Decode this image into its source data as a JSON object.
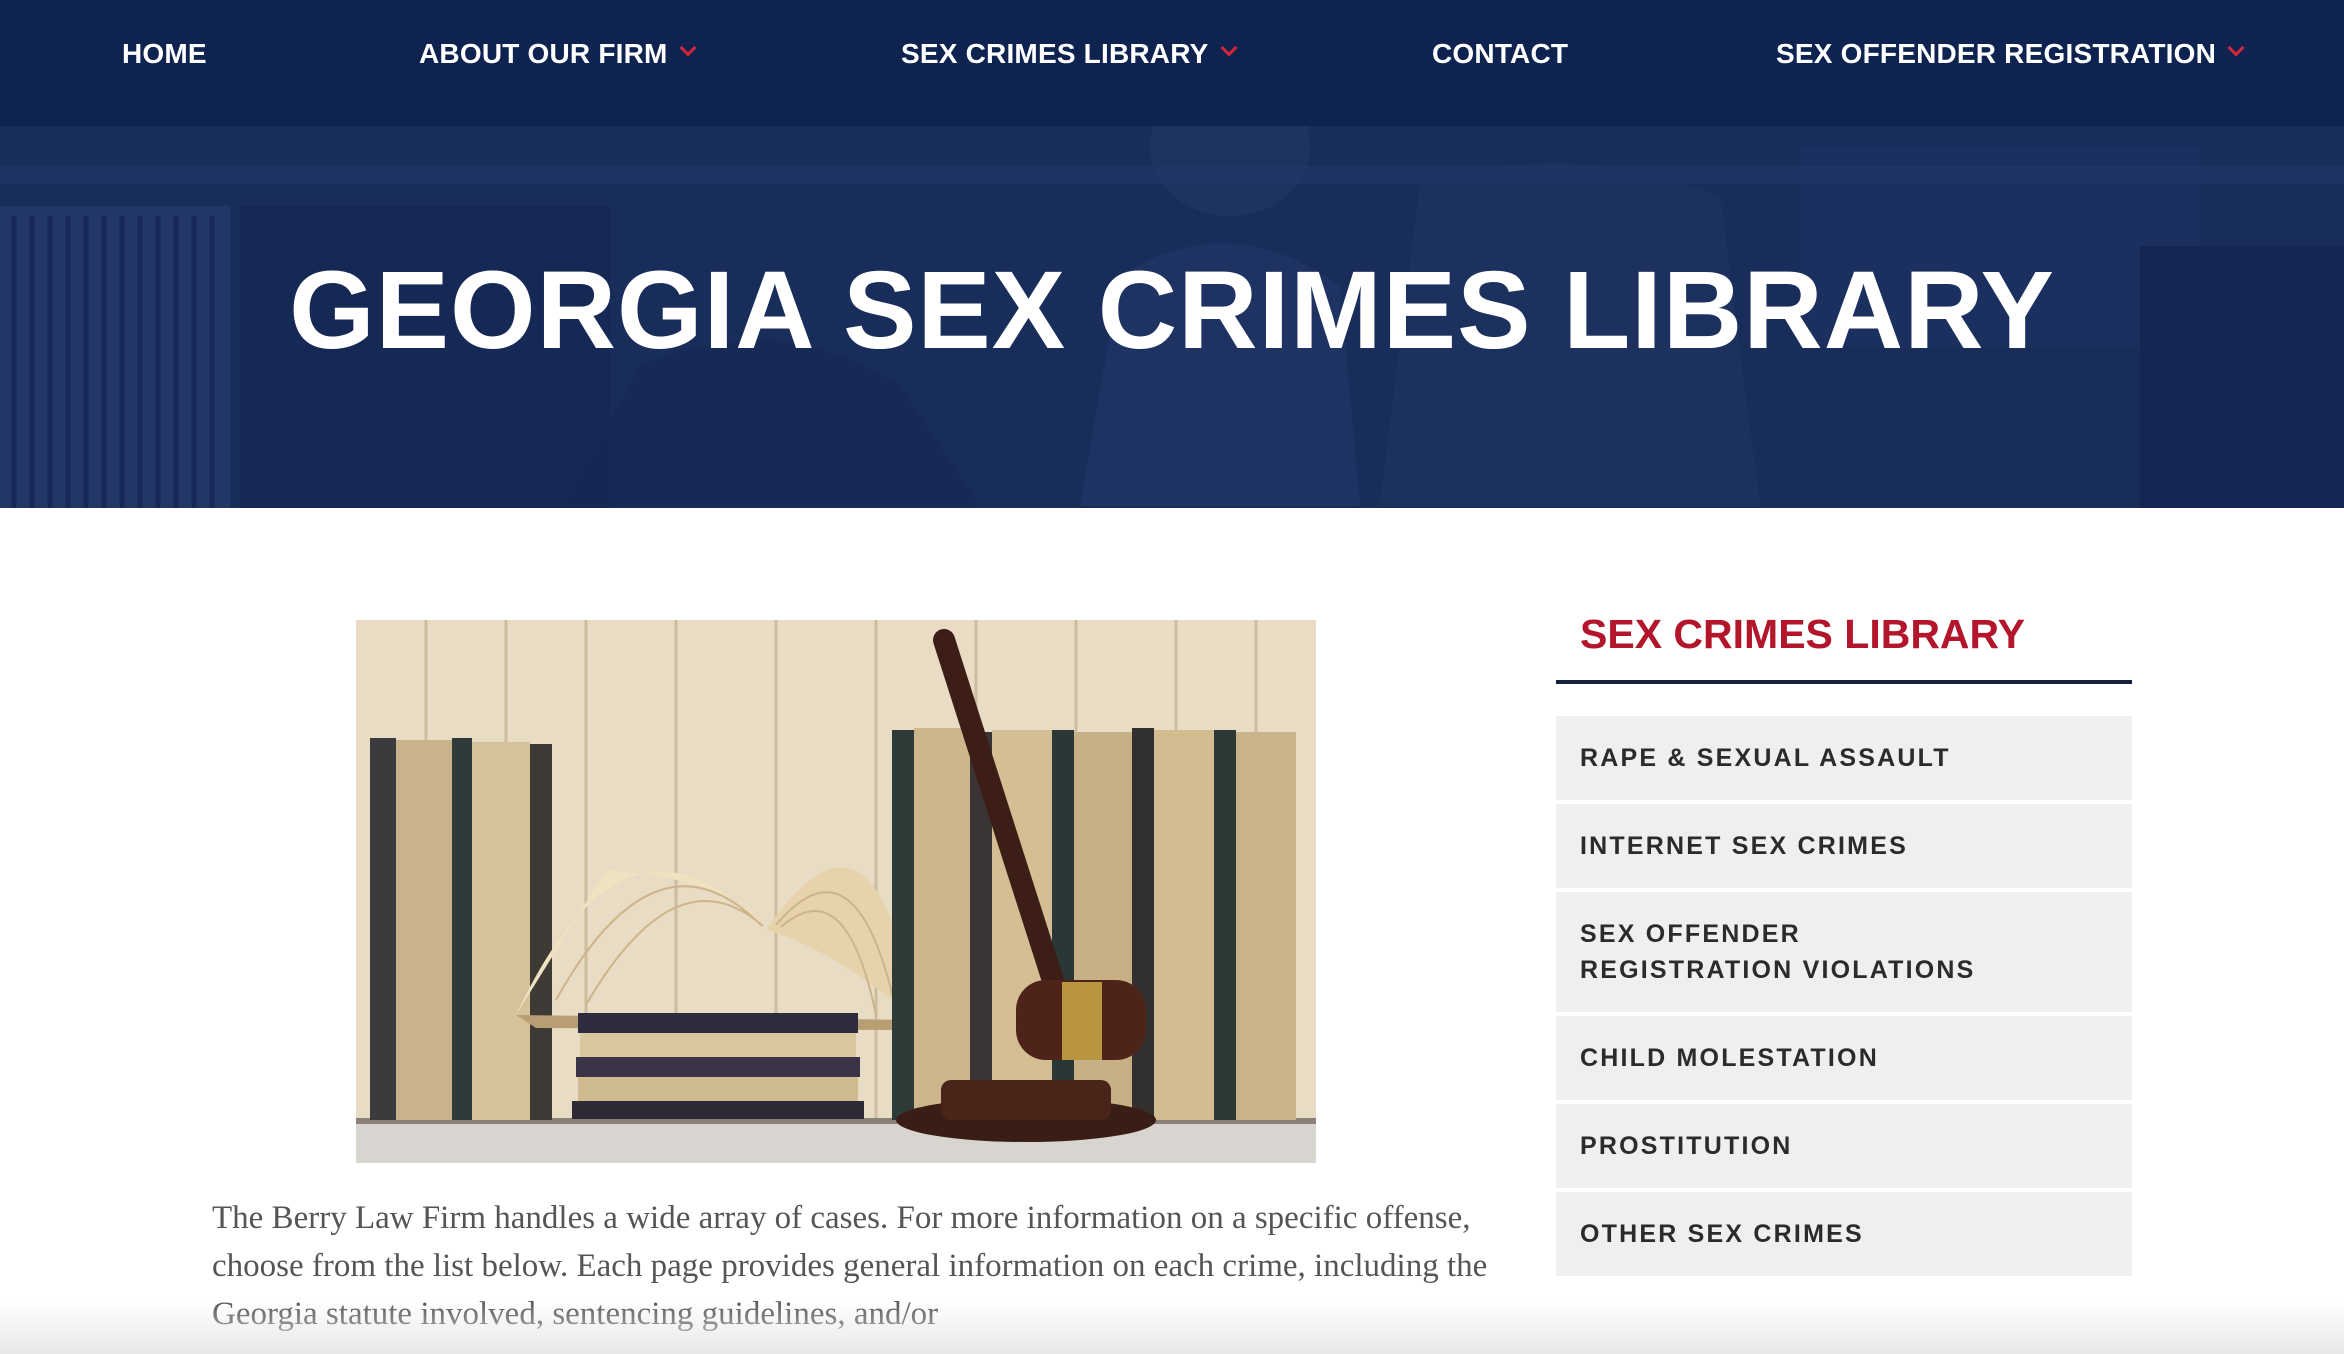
{
  "nav": {
    "items": [
      {
        "label": "HOME",
        "dropdown": false
      },
      {
        "label": "ABOUT OUR FIRM",
        "dropdown": true
      },
      {
        "label": "SEX CRIMES LIBRARY",
        "dropdown": true
      },
      {
        "label": "CONTACT",
        "dropdown": false
      },
      {
        "label": "SEX OFFENDER REGISTRATION",
        "dropdown": true
      }
    ]
  },
  "hero": {
    "title": "GEORGIA SEX CRIMES LIBRARY"
  },
  "main": {
    "intro": "The Berry Law Firm handles a wide array of cases. For more information on a specific offense, choose from the list below. Each page provides general information on each crime, including the Georgia statute involved, sentencing guidelines, and/or"
  },
  "sidebar": {
    "title": "SEX CRIMES LIBRARY",
    "items": [
      {
        "label": "RAPE & SEXUAL ASSAULT"
      },
      {
        "label": "INTERNET SEX CRIMES"
      },
      {
        "label": "SEX OFFENDER REGISTRATION VIOLATIONS"
      },
      {
        "label": "CHILD MOLESTATION"
      },
      {
        "label": "PROSTITUTION"
      },
      {
        "label": "OTHER SEX CRIMES"
      }
    ]
  },
  "colors": {
    "nav_bg": "#0e2350",
    "accent_red": "#b3152b",
    "sidebar_item_bg": "#efefef"
  }
}
